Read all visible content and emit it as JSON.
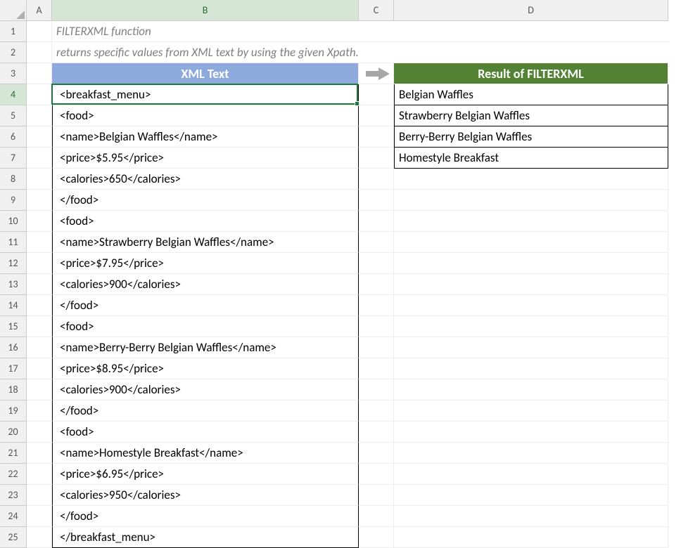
{
  "columns": [
    "A",
    "B",
    "C",
    "D"
  ],
  "rows": [
    "1",
    "2",
    "3",
    "4",
    "5",
    "6",
    "7",
    "8",
    "9",
    "10",
    "11",
    "12",
    "13",
    "14",
    "15",
    "16",
    "17",
    "18",
    "19",
    "20",
    "21",
    "22",
    "23",
    "24",
    "25"
  ],
  "active_cell": "B4",
  "title": "FILTERXML function",
  "subtitle": "returns specific values from XML text by using the given Xpath.",
  "headers": {
    "xml": "XML Text",
    "result": "Result of FILTERXML"
  },
  "xml_lines": [
    "<breakfast_menu>",
    "<food>",
    "<name>Belgian Waffles</name>",
    "<price>$5.95</price>",
    "<calories>650</calories>",
    "</food>",
    "<food>",
    "<name>Strawberry Belgian Waffles</name>",
    "<price>$7.95</price>",
    "<calories>900</calories>",
    "</food>",
    "<food>",
    "<name>Berry-Berry Belgian Waffles</name>",
    "<price>$8.95</price>",
    "<calories>900</calories>",
    "</food>",
    "<food>",
    "<name>Homestyle Breakfast</name>",
    "<price>$6.95</price>",
    "<calories>950</calories>",
    "</food>",
    "</breakfast_menu>"
  ],
  "results": [
    "Belgian Waffles",
    "Strawberry Belgian Waffles",
    "Berry-Berry Belgian Waffles",
    "Homestyle Breakfast"
  ],
  "arrow_color": "#a6a6a6"
}
